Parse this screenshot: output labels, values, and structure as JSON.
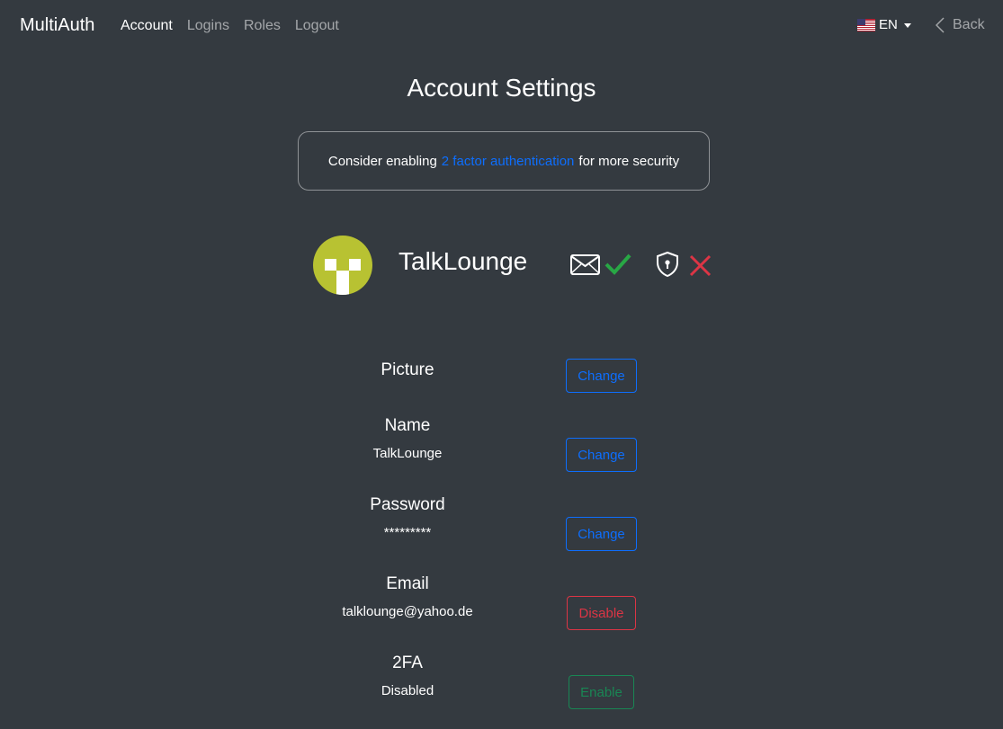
{
  "nav": {
    "brand": "MultiAuth",
    "links": [
      "Account",
      "Logins",
      "Roles",
      "Logout"
    ],
    "active": "Account",
    "language": "EN",
    "back_label": "Back"
  },
  "page": {
    "title": "Account Settings",
    "alert": {
      "prefix": "Consider enabling",
      "link": "2 factor authentication",
      "suffix": "for more security"
    }
  },
  "profile": {
    "username": "TalkLounge",
    "email_verified": true,
    "twofa_enabled": false,
    "avatar_color": "#b8c232"
  },
  "settings": {
    "picture": {
      "label": "Picture",
      "button": "Change"
    },
    "name": {
      "label": "Name",
      "value": "TalkLounge",
      "button": "Change"
    },
    "password": {
      "label": "Password",
      "value": "*********",
      "button": "Change"
    },
    "email": {
      "label": "Email",
      "value": "talklounge@yahoo.de",
      "button": "Disable"
    },
    "twofa": {
      "label": "2FA",
      "value": "Disabled",
      "button": "Enable"
    }
  },
  "colors": {
    "background": "#343a40",
    "primary": "#0d6efd",
    "danger": "#dc3545",
    "success": "#198754",
    "check": "#28a745"
  },
  "icons": [
    "flag-us-icon",
    "caret-down-icon",
    "chevron-left-icon",
    "envelope-icon",
    "check-icon",
    "shield-lock-icon",
    "x-icon"
  ]
}
